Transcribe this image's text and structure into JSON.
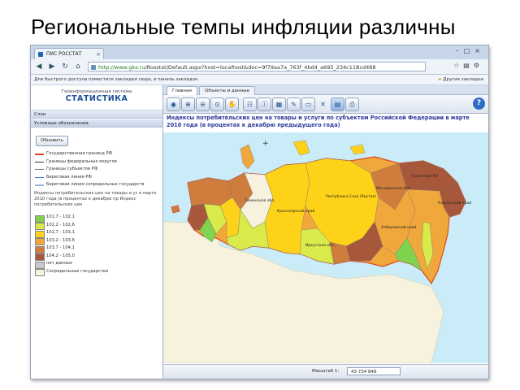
{
  "slide": {
    "title": "Региональные темпы инфляции различны"
  },
  "browser": {
    "tab_title": "ПИС РОССТАТ",
    "url_host": "http://www.gks.ru",
    "url_path": "/Rosstat/Default.aspx?host=localhost&doc=9f79aa7a_763f_4bd4_a695_234c11Bcd488",
    "bookmarks_hint": "Для быстрого доступа поместите закладки сюда, в панель закладок.",
    "other_bookmarks": "Другие закладки"
  },
  "sidebar": {
    "logo_subtitle": "Геоинформационная система",
    "logo_title": "СТАТИСТИКА",
    "layers_header": "Слои",
    "legend_header": "Условные обозначения",
    "refresh_label": "Обновить",
    "line_legend": [
      {
        "label": "Государственная граница РФ",
        "color": "#e0471f"
      },
      {
        "label": "Границы федеральных округов",
        "color": "#333333"
      },
      {
        "label": "Границы субъектов РФ",
        "color": "#777777"
      },
      {
        "label": "Береговая линия РФ",
        "color": "#3d7ad6"
      },
      {
        "label": "Береговая линия сопредельных государств",
        "color": "#9ab5d6"
      }
    ],
    "index_title": "Индексы потребительских цен на товары и ус в марте 2010 года (в процентах к декабрю пр Индекс потребительских цен",
    "color_legend": [
      {
        "label": "101,7 - 102,1",
        "color": "#7fd34e"
      },
      {
        "label": "102,2 - 102,6",
        "color": "#d9ea4a"
      },
      {
        "label": "102,7 - 103,1",
        "color": "#ffd21a"
      },
      {
        "label": "103,2 - 103,6",
        "color": "#f0a73c"
      },
      {
        "label": "103,7 - 104,1",
        "color": "#cf7d3c"
      },
      {
        "label": "104,2 - 105,0",
        "color": "#a8583a"
      },
      {
        "label": "нет данных",
        "color": "#c8c8c8"
      },
      {
        "label": "Сопредельные государства",
        "color": "#f7f2de"
      }
    ]
  },
  "mainview": {
    "tabs": [
      "Главная",
      "Объекты и данные"
    ],
    "map_title": "Индексы потребительских цен на товары и услуги по субъектам Российской Федерации в марте 2010 года (в процентах к декабрю предыдущего года)",
    "scale_label": "Масштаб 1:",
    "scale_value": "43 734 849",
    "region_labels": [
      "Красноярский край",
      "Республика Саха (Якутия)",
      "Магаданская обл.",
      "Чукотский АО",
      "Камчатский край",
      "Хабаровский край",
      "Иркутская обл.",
      "Тюменская обл."
    ]
  },
  "icons": {
    "nav_back": "back-arrow-icon",
    "nav_forward": "forward-arrow-icon",
    "reload": "reload-icon",
    "home": "home-icon",
    "help": "help-icon"
  }
}
